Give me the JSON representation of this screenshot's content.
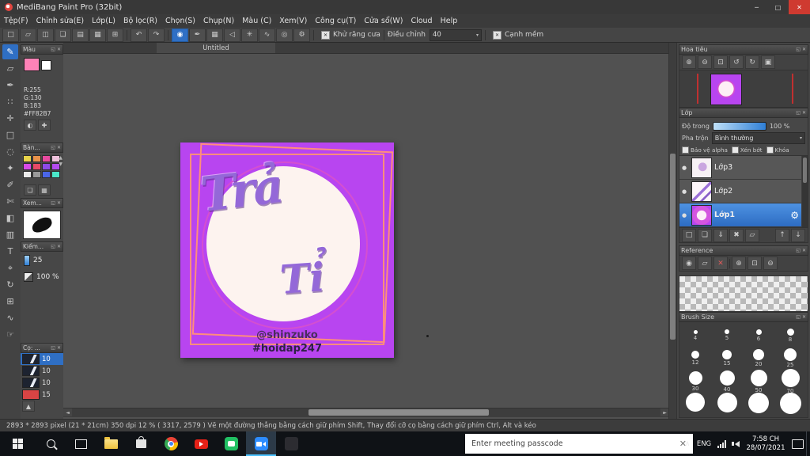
{
  "window": {
    "title": "MediBang Paint Pro (32bit)"
  },
  "icons": {
    "min": "─",
    "max": "□",
    "close": "✕",
    "popout": "◱",
    "dropdown": "▾",
    "check": "✕",
    "undo": "↶",
    "redo": "↷",
    "up": "▲",
    "down": "▼",
    "left": "◄",
    "right": "►",
    "eye": "●",
    "gear": "⚙",
    "chevron": "∧"
  },
  "menu": {
    "items": [
      "Tệp(F)",
      "Chỉnh sửa(E)",
      "Lớp(L)",
      "Bộ lọc(R)",
      "Chọn(S)",
      "Chụp(N)",
      "Màu (C)",
      "Xem(V)",
      "Công cụ(T)",
      "Cửa sổ(W)",
      "Cloud",
      "Help"
    ]
  },
  "toolbar": {
    "file_glyphs": [
      "□",
      "▱",
      "◫",
      "❏",
      "▤",
      "▦",
      "⊞"
    ],
    "draw_glyphs": [
      "◉",
      "✒",
      "▦",
      "◁",
      "✳",
      "∿",
      "◎",
      "⚙"
    ],
    "antialias_label": "Khử răng cưa",
    "adjust_label": "Điều chỉnh",
    "adjust_value": "40",
    "soft_edge_label": "Cạnh mềm"
  },
  "tools": [
    {
      "name": "brush",
      "glyph": "✎"
    },
    {
      "name": "eraser",
      "glyph": "▱"
    },
    {
      "name": "pen",
      "glyph": "✒"
    },
    {
      "name": "dot",
      "glyph": "∷"
    },
    {
      "name": "move",
      "glyph": "✛"
    },
    {
      "name": "select",
      "glyph": "□"
    },
    {
      "name": "lasso",
      "glyph": "◌"
    },
    {
      "name": "magic-wand",
      "glyph": "✦"
    },
    {
      "name": "select-pen",
      "glyph": "✐"
    },
    {
      "name": "select-eraser",
      "glyph": "✄"
    },
    {
      "name": "bucket",
      "glyph": "◧"
    },
    {
      "name": "gradient",
      "glyph": "▥"
    },
    {
      "name": "text",
      "glyph": "T"
    },
    {
      "name": "eyedropper",
      "glyph": "⌖"
    },
    {
      "name": "rotate",
      "glyph": "↻"
    },
    {
      "name": "grid",
      "glyph": "⊞"
    },
    {
      "name": "curve",
      "glyph": "∿"
    },
    {
      "name": "hand",
      "glyph": "☞"
    }
  ],
  "left_panels": {
    "color": {
      "title": "Màu",
      "current": "#ff82b7",
      "r": "R:255",
      "g": "G:130",
      "b": "B:183",
      "hex": "#FF82B7",
      "btn_glyphs": [
        "◐",
        "✚"
      ]
    },
    "palette": {
      "title": "Bàn...",
      "btn_glyphs": [
        "❏",
        "▦"
      ],
      "colors": [
        "#e8d44a",
        "#e8924a",
        "#e84aa0",
        "#eec2dc",
        "#d84ae8",
        "#e84a66",
        "#8e4ae8",
        "#b44af0",
        "#ececec",
        "#9a9a9a",
        "#4a66e8",
        "#4ae8c8"
      ]
    },
    "preview": {
      "title": "Xem..."
    },
    "control": {
      "title": "Kiểm...",
      "size_value": "25",
      "opacity_value": "100 %"
    },
    "brushes": {
      "title": "Cọ: ...",
      "items": [
        {
          "label": "10"
        },
        {
          "label": "10"
        },
        {
          "label": "10"
        },
        {
          "label": "15",
          "color": "#d84444"
        }
      ]
    }
  },
  "canvas": {
    "tab": "Untitled"
  },
  "artwork": {
    "bg": "#b845f0",
    "circle": "#fdf3ef",
    "ring": "#d44fd0",
    "frame": "#ff8d7c",
    "text_color": "#9468d8",
    "word1": "Trả",
    "word2": "Tỉ",
    "handle": "@shinzuko",
    "handle_color": "#4a2d5e",
    "hashtag": "#hoidap247",
    "hashtag_color": "#2e2144"
  },
  "navigator": {
    "title": "Hoa tiêu",
    "btn_glyphs": [
      "⊕",
      "⊖",
      "⊡",
      "↺",
      "↻",
      "▣"
    ]
  },
  "layers": {
    "title": "Lớp",
    "opacity_label": "Độ trong",
    "opacity_value": "100 %",
    "blend_label": "Pha trộn",
    "blend_value": "Bình thường",
    "checks": [
      "Bảo vệ alpha",
      "Xén bớt",
      "Khóa"
    ],
    "items": [
      {
        "name": "Lớp3"
      },
      {
        "name": "Lớp2"
      },
      {
        "name": "Lớp1"
      }
    ],
    "btn_glyphs": [
      "□",
      "❏",
      "⇓",
      "✖",
      "▱",
      "↑",
      "↓"
    ]
  },
  "reference": {
    "title": "Reference",
    "btn_glyphs": [
      "◉",
      "▱",
      "✕",
      "⊕",
      "⊡",
      "⊖"
    ]
  },
  "brush_size": {
    "title": "Brush Size",
    "rows": [
      [
        "4",
        "5",
        "6",
        "8"
      ],
      [
        "12",
        "15",
        "20",
        "25"
      ],
      [
        "30",
        "40",
        "50",
        "70"
      ],
      [
        "",
        "",
        "",
        ""
      ]
    ]
  },
  "status": {
    "text": "2893 * 2893 pixel   (21 * 21cm)   350 dpi   12 %   ( 3317, 2579 )   Vẽ một đường thẳng bằng cách giữ phím Shift, Thay đổi cỡ cọ bằng cách giữ phím Ctrl, Alt và kéo"
  },
  "taskbar": {
    "meeting_input": "Enter meeting passcode",
    "lang": "ENG",
    "time": "7:58 CH",
    "date": "28/07/2021"
  }
}
